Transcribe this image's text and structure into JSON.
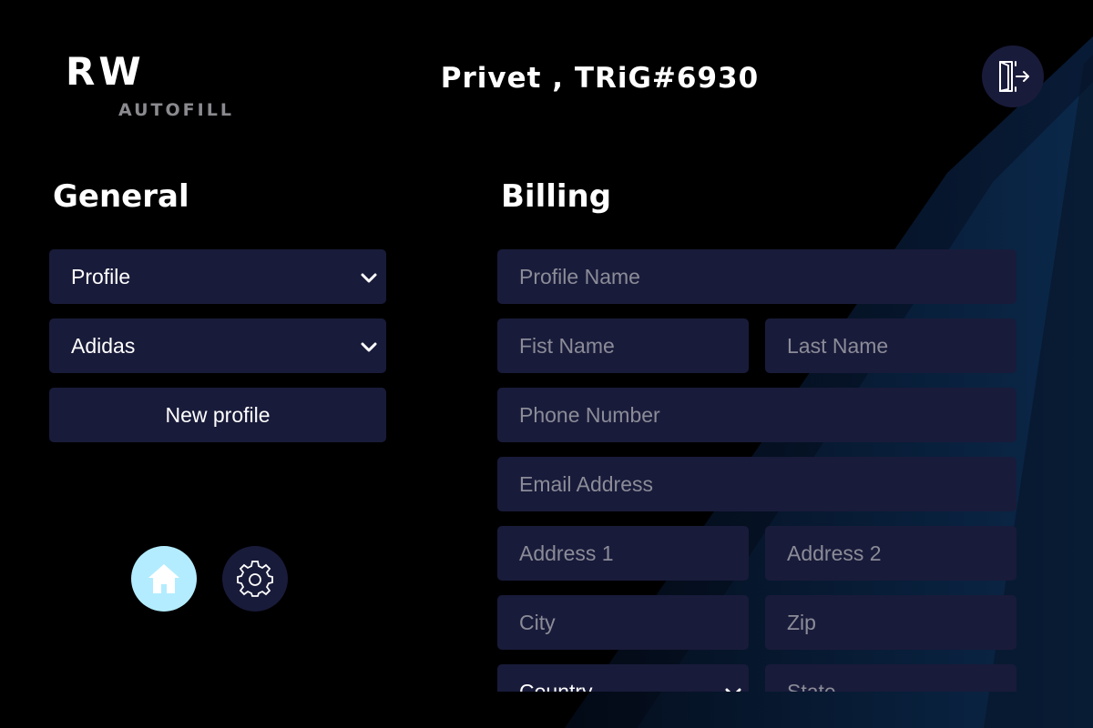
{
  "logo": {
    "main": "RW",
    "sub": "AUTOFILL"
  },
  "header": {
    "greeting": "Privet , TRiG#6930",
    "logout_icon": "logout-door-icon"
  },
  "general": {
    "title": "General",
    "profile_select": "Profile",
    "store_select": "Adidas",
    "new_profile_label": "New profile"
  },
  "nav": {
    "home_icon": "home-icon",
    "settings_icon": "gear-icon",
    "active": "home"
  },
  "billing": {
    "title": "Billing",
    "fields": {
      "profile_name": "Profile Name",
      "first_name": "Fist Name",
      "last_name": "Last Name",
      "phone": "Phone Number",
      "email": "Email Address",
      "address1": "Address 1",
      "address2": "Address 2",
      "city": "City",
      "zip": "Zip",
      "country": "Country",
      "state": "State"
    }
  },
  "colors": {
    "background": "#000000",
    "panel": "#191b3a",
    "accent": "#b3ecff",
    "placeholder": "#8b8c98"
  }
}
